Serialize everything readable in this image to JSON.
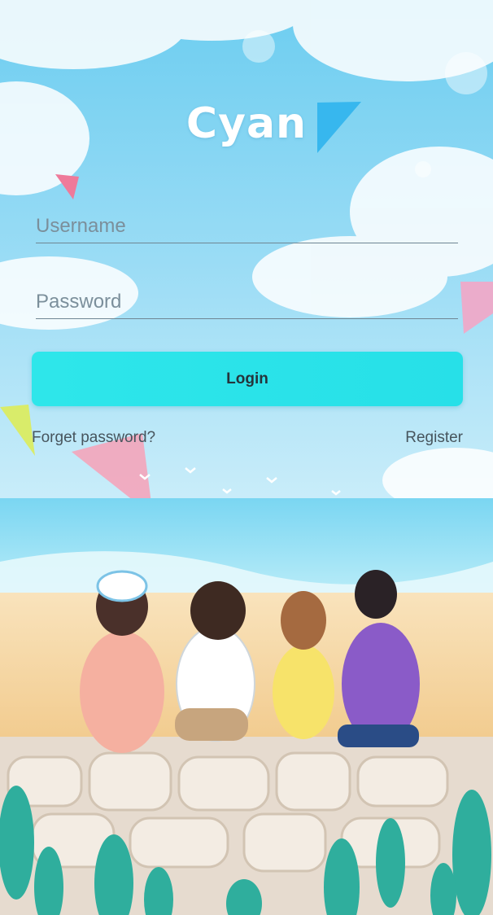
{
  "app": {
    "title": "Cyan"
  },
  "form": {
    "username_placeholder": "Username",
    "password_placeholder": "Password",
    "login_label": "Login",
    "forgot_label": "Forget password?",
    "register_label": "Register"
  },
  "colors": {
    "accent": "#2ee6ea",
    "sky": "#5fc6ea",
    "sea": "#6fd0ec",
    "sand": "#f3d49b"
  }
}
